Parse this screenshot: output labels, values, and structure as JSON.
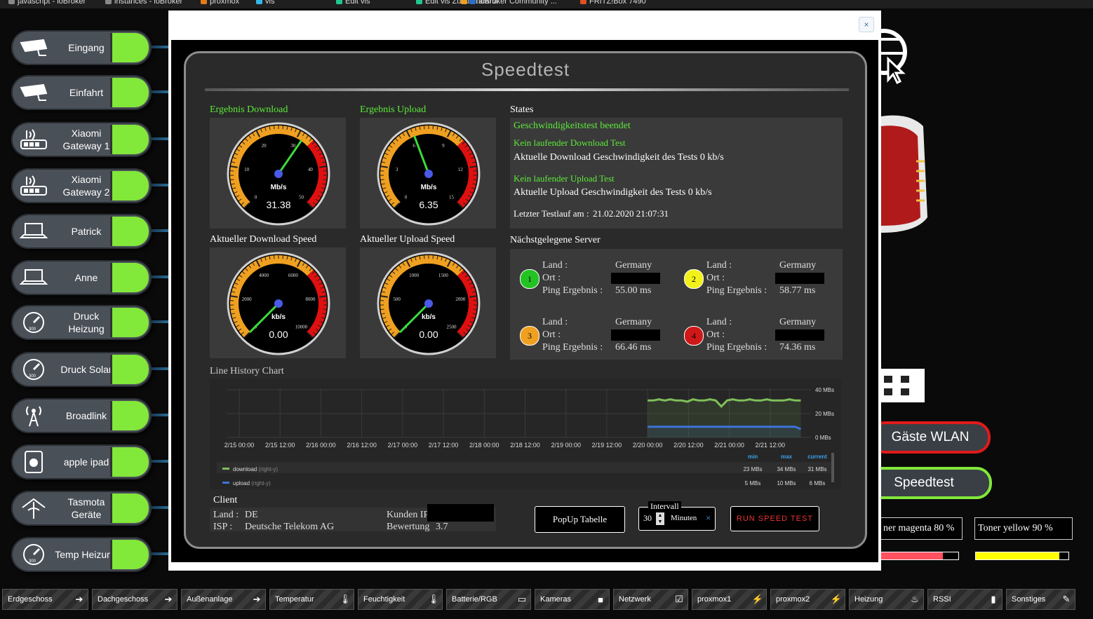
{
  "bookmarks": [
    "javascript - ioBroker",
    "instances - ioBroker",
    "proxmox",
    "vis",
    "Edit vis",
    "Edit vis Zukunft",
    "Grafana",
    "ioBroker Community ...",
    "FRITZ!Box 7490"
  ],
  "devices": [
    {
      "label": "Eingang",
      "icon": "camera-icon"
    },
    {
      "label": "Einfahrt",
      "icon": "camera-icon"
    },
    {
      "label": "Xiaomi Gateway 1",
      "icon": "router-icon"
    },
    {
      "label": "Xiaomi Gateway 2",
      "icon": "router-icon"
    },
    {
      "label": "Patrick",
      "icon": "laptop-icon"
    },
    {
      "label": "Anne",
      "icon": "laptop-icon"
    },
    {
      "label": "Druck Heizung",
      "icon": "gauge-icon"
    },
    {
      "label": "Druck Solar",
      "icon": "gauge-icon"
    },
    {
      "label": "Broadlink",
      "icon": "antenna-icon"
    },
    {
      "label": "apple ipad",
      "icon": "apple-icon"
    },
    {
      "label": "Tasmota Geräte",
      "icon": "wifi-plug-icon"
    },
    {
      "label": "Temp Heizung",
      "icon": "gauge-icon"
    }
  ],
  "right": {
    "guest_wlan": "Gäste WLAN",
    "speedtest": "Speedtest",
    "toner_magenta": "ner magenta 80 %",
    "toner_yellow": "Toner yellow 90 %",
    "toner_magenta_level": 0.8,
    "toner_yellow_level": 0.9
  },
  "nav": [
    {
      "label": "Erdgeschoss",
      "icon": "arrow-icon"
    },
    {
      "label": "Dachgeschoss",
      "icon": "arrow-icon"
    },
    {
      "label": "Außenanlage",
      "icon": "arrow-icon"
    },
    {
      "label": "Temperatur",
      "icon": "thermometer-icon"
    },
    {
      "label": "Feuchtigkeit",
      "icon": "thermometer-icon"
    },
    {
      "label": "Batterie/RGB",
      "icon": "battery-icon"
    },
    {
      "label": "Kameras",
      "icon": "video-icon"
    },
    {
      "label": "Netzwerk",
      "icon": "checkbox-icon"
    },
    {
      "label": "proxmox1",
      "icon": "bolt-icon"
    },
    {
      "label": "proxmox2",
      "icon": "bolt-icon"
    },
    {
      "label": "Heizung",
      "icon": "flame-icon"
    },
    {
      "label": "RSSI",
      "icon": "signal-icon"
    },
    {
      "label": "Sonstiges",
      "icon": "pencil-icon"
    }
  ],
  "modal": {
    "close": "×",
    "title": "Speedtest",
    "ergebnis_download": "Ergebnis Download",
    "ergebnis_upload": "Ergebnis Upload",
    "aktueller_download": "Aktueller Download Speed",
    "aktueller_upload": "Aktueller Upload Speed",
    "states_title": "States",
    "states": {
      "line1": "Geschwindigkeitstest beendet",
      "line2": "Kein laufender Download Test",
      "line3": "Aktuelle Download Geschwindigkeit des Tests 0 kb/s",
      "line4": "Kein laufender Upload Test",
      "line5": "Aktuelle Upload Geschwindigkeit des Tests 0 kb/s",
      "line6_label": "Letzter Testlauf am :",
      "line6_value": "21.02.2020 21:07:31"
    },
    "servers_title": "Nächstgelegene Server",
    "server_labels": {
      "land": "Land :",
      "ort": "Ort :",
      "ping": "Ping Ergebnis :"
    },
    "servers": [
      {
        "num": "1",
        "color": "#22c322",
        "land": "Germany",
        "ping": "55.00 ms"
      },
      {
        "num": "2",
        "color": "#f2f21a",
        "land": "Germany",
        "ping": "58.77 ms"
      },
      {
        "num": "3",
        "color": "#f0a020",
        "land": "Germany",
        "ping": "66.46 ms"
      },
      {
        "num": "4",
        "color": "#d01818",
        "land": "Germany",
        "ping": "74.36 ms"
      }
    ],
    "history_title": "Line History Chart",
    "client": {
      "title": "Client",
      "land_label": "Land :",
      "land": "DE",
      "isp_label": "ISP :",
      "isp": "Deutsche Telekom AG",
      "ip_label": "Kunden IP",
      "bewertung_label": "Bewertung",
      "bewertung": "3.7"
    },
    "popup_button": "PopUp Tabelle",
    "interval_label": "Intervall",
    "interval_value": "30",
    "interval_unit": "Minuten",
    "interval_clear": "×",
    "run_button": "RUN SPEED TEST"
  },
  "gauges": [
    {
      "id": "g1",
      "unit": "Mb/s",
      "value": 31.38,
      "display": "31.38",
      "min": 0,
      "max": 50,
      "ticks": [
        "0",
        "10",
        "20",
        "30",
        "40",
        "50"
      ]
    },
    {
      "id": "g2",
      "unit": "Mb/s",
      "value": 6.35,
      "display": "6.35",
      "min": 0,
      "max": 15,
      "ticks": [
        "0",
        "3",
        "6",
        "9",
        "12",
        "15"
      ]
    },
    {
      "id": "g3",
      "unit": "kb/s",
      "value": 0,
      "display": "0.00",
      "min": 0,
      "max": 10000,
      "ticks": [
        "0",
        "2000",
        "4000",
        "6000",
        "8000",
        "10000"
      ]
    },
    {
      "id": "g4",
      "unit": "kb/s",
      "value": 0,
      "display": "0.00",
      "min": 0,
      "max": 2500,
      "ticks": [
        "0",
        "500",
        "1000",
        "1500",
        "2000",
        "2500"
      ]
    }
  ],
  "chart_data": {
    "type": "line",
    "title": "Line History Chart",
    "x_ticks": [
      "2/15 00:00",
      "2/15 12:00",
      "2/16 00:00",
      "2/16 12:00",
      "2/17 00:00",
      "2/17 12:00",
      "2/18 00:00",
      "2/18 12:00",
      "2/19 00:00",
      "2/19 12:00",
      "2/20 00:00",
      "2/20 12:00",
      "2/21 00:00",
      "2/21 12:00"
    ],
    "y_ticks": [
      "40 MBs",
      "20 MBs",
      "0 MBs"
    ],
    "ylim": [
      0,
      40
    ],
    "x_range": [
      "2/15 00:00",
      "2/22 00:00"
    ],
    "series": [
      {
        "name": "download",
        "axis": "(right-y)",
        "color": "#7fbf5a",
        "x_start": "2/20 00:00",
        "x_end": "2/21 21:00",
        "values": [
          31,
          31,
          32,
          31,
          32,
          31,
          31,
          30,
          32,
          31,
          31,
          32,
          31,
          26,
          31,
          32,
          31,
          31,
          32,
          31,
          31,
          32,
          31,
          31,
          31,
          32,
          31,
          31
        ],
        "min": "23 MBs",
        "max": "34 MBs",
        "current": "31 MBs"
      },
      {
        "name": "upload",
        "axis": "(right-y)",
        "color": "#3a74d8",
        "x_start": "2/20 00:00",
        "x_end": "2/21 21:00",
        "values": [
          9,
          9,
          9,
          9,
          9,
          9,
          9,
          9,
          9,
          9,
          9,
          9,
          9,
          9,
          9,
          9,
          9,
          9,
          9,
          9,
          9,
          9,
          9,
          9,
          9,
          9,
          9,
          7
        ],
        "min": "5 MBs",
        "max": "10 MBs",
        "current": "6 MBs"
      }
    ],
    "legend_headers": [
      "min",
      "max",
      "current"
    ]
  }
}
